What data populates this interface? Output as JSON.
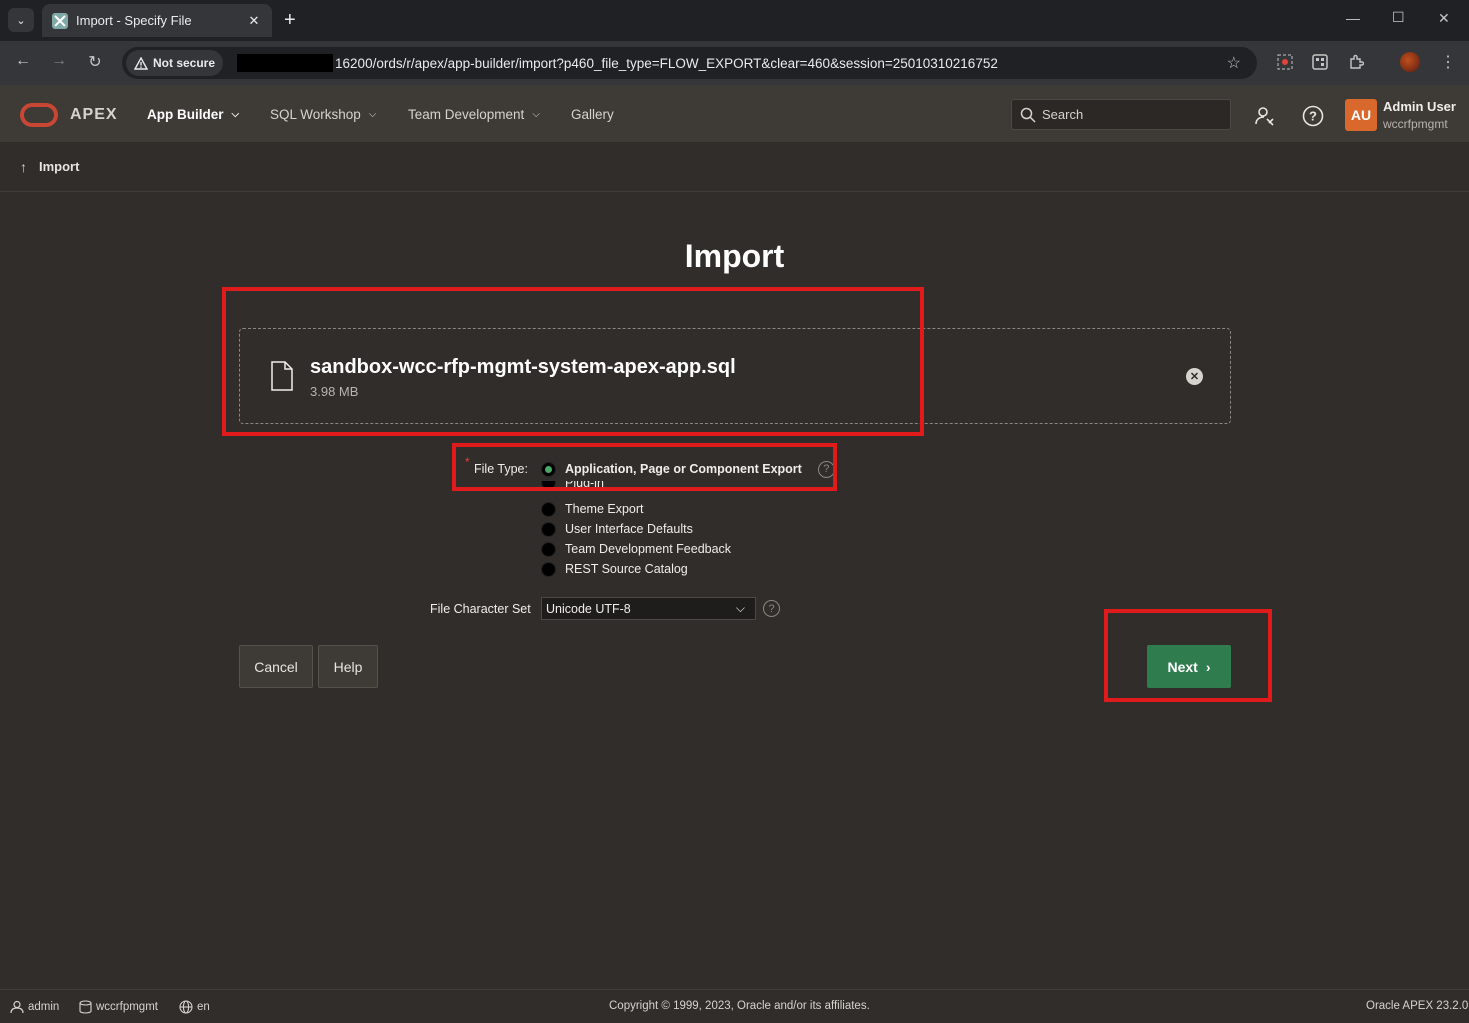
{
  "browser": {
    "tab_title": "Import - Specify File",
    "not_secure_label": "Not secure",
    "url": "16200/ords/r/apex/app-builder/import?p460_file_type=FLOW_EXPORT&clear=460&session=25010310216752"
  },
  "header": {
    "logo_text": "APEX",
    "menu": [
      {
        "label": "App Builder"
      },
      {
        "label": "SQL Workshop"
      },
      {
        "label": "Team Development"
      },
      {
        "label": "Gallery"
      }
    ],
    "search_placeholder": "Search",
    "user": {
      "initials": "AU",
      "name": "Admin User",
      "workspace": "wccrfpmgmt"
    }
  },
  "breadcrumb": {
    "label": "Import"
  },
  "page": {
    "title": "Import",
    "file": {
      "name": "sandbox-wcc-rfp-mgmt-system-apex-app.sql",
      "size": "3.98 MB"
    },
    "file_type_label": "File Type:",
    "file_type_options": [
      {
        "label": "Application, Page or Component Export",
        "selected": true
      },
      {
        "label": "Plug-in",
        "selected": false
      },
      {
        "label": "Theme Export",
        "selected": false
      },
      {
        "label": "User Interface Defaults",
        "selected": false
      },
      {
        "label": "Team Development Feedback",
        "selected": false
      },
      {
        "label": "REST Source Catalog",
        "selected": false
      }
    ],
    "charset_label": "File Character Set",
    "charset_value": "Unicode UTF-8",
    "buttons": {
      "cancel": "Cancel",
      "help": "Help",
      "next": "Next"
    }
  },
  "footer": {
    "user": "admin",
    "workspace": "wccrfpmgmt",
    "language": "en",
    "copyright": "Copyright © 1999, 2023, Oracle and/or its affiliates.",
    "version": "Oracle APEX 23.2.0"
  },
  "colors": {
    "accent_green": "#2f7d4f",
    "highlight_red": "#e01b1b",
    "avatar_orange": "#d9682c"
  }
}
